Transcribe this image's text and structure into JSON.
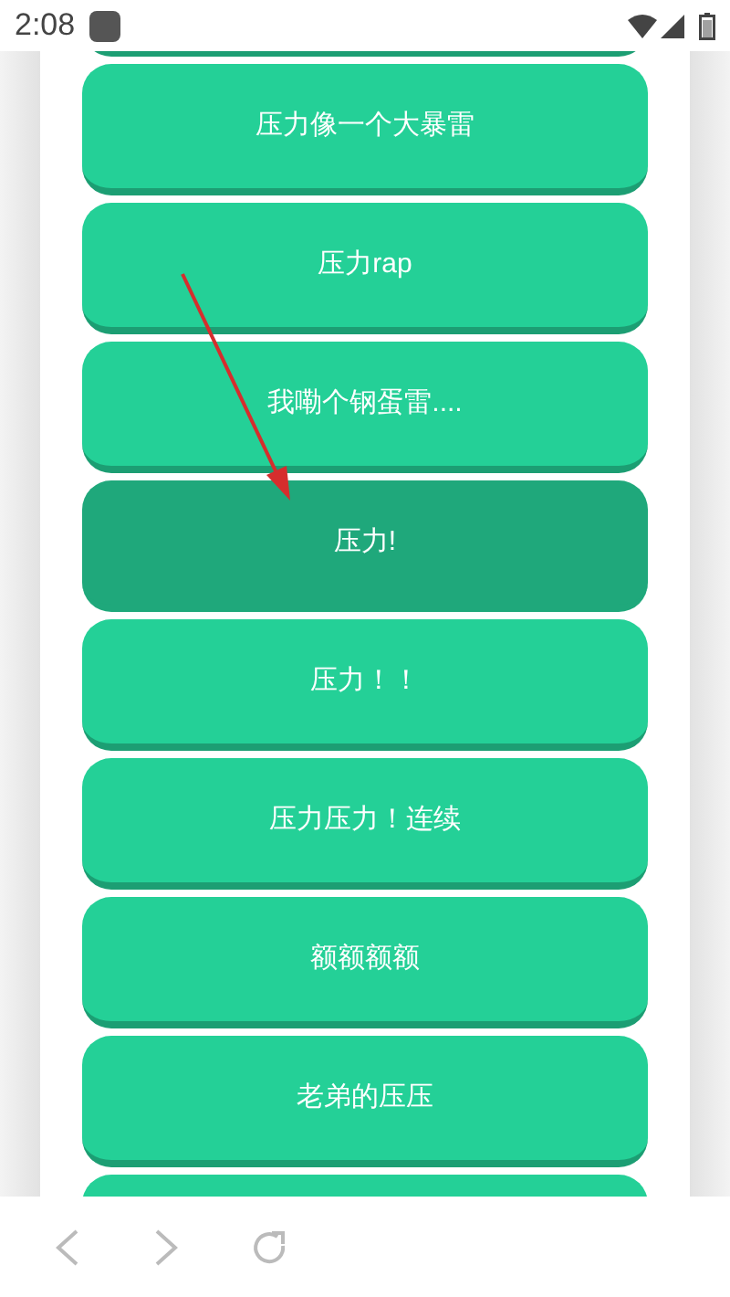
{
  "status_bar": {
    "time": "2:08"
  },
  "buttons": [
    {
      "label": "压力像一个大暴雷",
      "pressed": false
    },
    {
      "label": "压力rap",
      "pressed": false
    },
    {
      "label": "我嘞个钢蛋雷....",
      "pressed": false
    },
    {
      "label": "压力!",
      "pressed": true
    },
    {
      "label": "压力！！",
      "pressed": false
    },
    {
      "label": "压力压力！连续",
      "pressed": false
    },
    {
      "label": "额额额额",
      "pressed": false
    },
    {
      "label": "老弟的压压",
      "pressed": false
    }
  ],
  "annotation": {
    "kind": "arrow"
  },
  "browser_nav": {
    "kind": "back-forward-reload"
  }
}
